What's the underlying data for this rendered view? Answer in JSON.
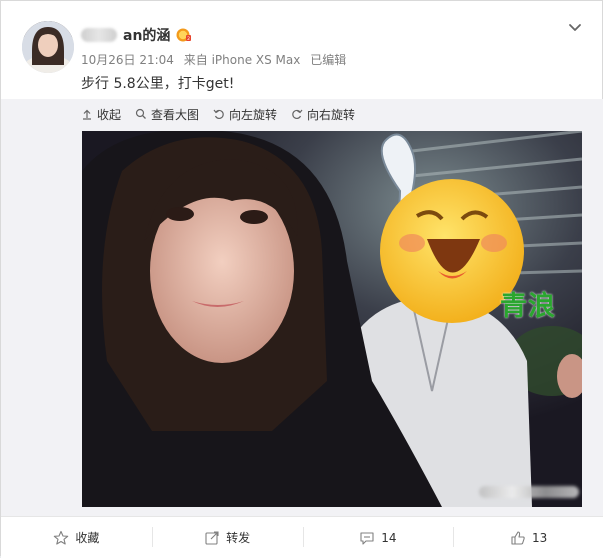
{
  "post": {
    "author": "an的涵",
    "date": "10月26日 21:04",
    "source": "来自 iPhone XS Max",
    "edited": "已编辑",
    "text": "步行 5.8公里，打卡get!"
  },
  "media_toolbar": {
    "collapse": "收起",
    "view_large": "查看大图",
    "rotate_left": "向左旋转",
    "rotate_right": "向右旋转"
  },
  "image": {
    "sticker_text": "青浪"
  },
  "actions": {
    "favorite": "收藏",
    "repost": "转发",
    "comment_count": "14",
    "like_count": "13"
  },
  "colors": {
    "text_primary": "#333333",
    "text_secondary": "#808080",
    "toolbar_bg": "#f2f2f5",
    "sticker_green": "#2aa62f",
    "vip_orange": "#f39a1b"
  },
  "icons": [
    "chevron-down-icon",
    "collapse-up-icon",
    "magnifier-icon",
    "rotate-left-icon",
    "rotate-right-icon",
    "star-icon",
    "repost-icon",
    "comment-icon",
    "thumb-up-icon",
    "vip-badge-icon"
  ]
}
